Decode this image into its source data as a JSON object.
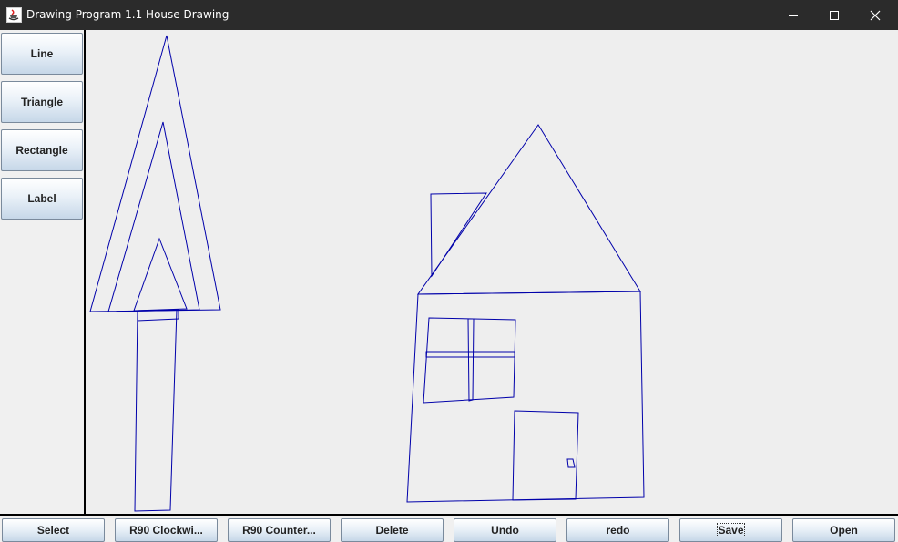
{
  "window": {
    "title": "Drawing Program 1.1  House Drawing",
    "icons": {
      "app": "java-app-icon",
      "minimize": "minimize-icon",
      "maximize": "maximize-icon",
      "close": "close-icon"
    }
  },
  "sidebar": {
    "items": [
      {
        "label": "Line"
      },
      {
        "label": "Triangle"
      },
      {
        "label": "Rectangle"
      },
      {
        "label": "Label"
      }
    ]
  },
  "toolbar": {
    "buttons": [
      {
        "label": "Select"
      },
      {
        "label": "R90 Clockwi..."
      },
      {
        "label": "R90 Counter..."
      },
      {
        "label": "Delete"
      },
      {
        "label": "Undo"
      },
      {
        "label": "redo"
      },
      {
        "label": "Save",
        "focused": true
      },
      {
        "label": "Open"
      }
    ]
  },
  "colors": {
    "stroke": "#0000aa",
    "titlebar": "#2b2b2b",
    "canvas": "#eeeeee"
  }
}
